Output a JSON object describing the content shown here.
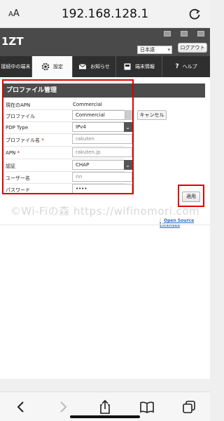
{
  "browser": {
    "aa_label_small": "A",
    "aa_label_large": "A",
    "url": "192.168.128.1"
  },
  "header": {
    "brand": "1ZT",
    "language": "日本語",
    "logout": "ログアウト"
  },
  "nav": {
    "items": [
      {
        "label": "接続中の端末",
        "icon": ""
      },
      {
        "label": "設定",
        "icon": "gear-icon"
      },
      {
        "label": "お知らせ",
        "icon": "envelope-icon"
      },
      {
        "label": "端末情報",
        "icon": "info-card-icon"
      },
      {
        "label": "ヘルプ",
        "icon": "question-icon"
      }
    ]
  },
  "profile": {
    "title": "プロファイル管理",
    "current_apn_label": "現在のAPN",
    "current_apn_value": "Commercial",
    "profile_label": "プロファイル",
    "profile_value": "Commercial",
    "cancel": "キャンセル",
    "pdp_label": "PDP Type",
    "pdp_value": "IPv4",
    "profile_name_label": "プロファイル名",
    "profile_name_value": "rakuten",
    "apn_label": "APN",
    "apn_value": "rakuten.jp",
    "auth_label": "認証",
    "auth_value": "CHAP",
    "username_label": "ユーザー名",
    "username_value": "rin",
    "password_label": "パスワード",
    "password_value": "••••",
    "required_mark": "*",
    "apply": "適用"
  },
  "footer": {
    "separator": "|",
    "open_source": "Open Source Licenses"
  },
  "watermark": "©Wi-Fiの森   https://wifinomori.com",
  "colors": {
    "highlight": "#e10000",
    "header_bg": "#4a4a4a",
    "nav_bg": "#2f2f2f",
    "link": "#2a6fc9"
  }
}
